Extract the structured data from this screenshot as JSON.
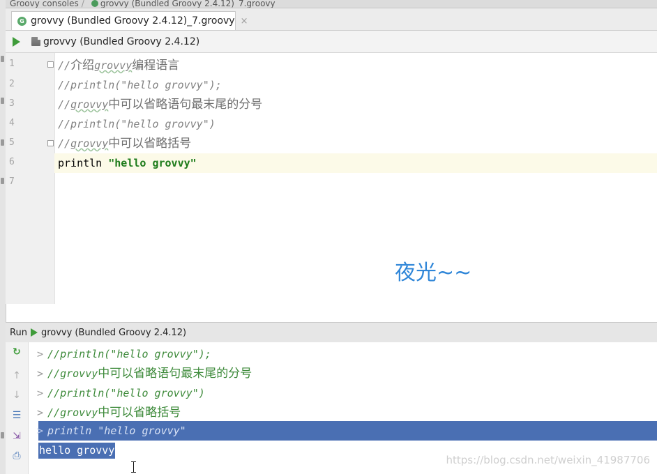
{
  "breadcrumb": {
    "root": "Groovy consoles",
    "file": "grovvy (Bundled Groovy 2.4.12)_7.groovy"
  },
  "tab": {
    "icon": "groovy-file-icon",
    "label": "grovvy (Bundled Groovy 2.4.12)_7.groovy",
    "close": "×"
  },
  "toolbar": {
    "run_config_label": "grovvy (Bundled Groovy 2.4.12)"
  },
  "editor": {
    "line_numbers": [
      "1",
      "2",
      "3",
      "4",
      "5",
      "6",
      "7"
    ],
    "lines": [
      {
        "prefix": "//",
        "cn1": "介绍",
        "mono": "grovvy",
        "cn2": "编程语言"
      },
      {
        "text": "//println(\"hello grovvy\");"
      },
      {
        "prefix": "//",
        "mono": "grovvy",
        "cn2": "中可以省略语句最末尾的分号"
      },
      {
        "text": "//println(\"hello grovvy\")"
      },
      {
        "prefix": "//",
        "mono": "grovvy",
        "cn2": "中可以省略括号"
      },
      {
        "keyword": "println ",
        "string": "\"hello grovvy\""
      }
    ],
    "overlay_text": "夜光~~"
  },
  "run_panel": {
    "run_label": "Run",
    "config_label": "grovvy (Bundled Groovy 2.4.12)",
    "prompt": ">",
    "output": [
      {
        "text": "//println(\"hello grovvy\");"
      },
      {
        "mono": "//grovvy",
        "cn": "中可以省略语句最末尾的分号"
      },
      {
        "text": "//println(\"hello grovvy\")"
      },
      {
        "mono": "//grovvy",
        "cn": "中可以省略括号"
      },
      {
        "text": "println \"hello grovvy\""
      }
    ],
    "result": "hello grovvy"
  },
  "watermark": "https://blog.csdn.net/weixin_41987706",
  "colors": {
    "accent_green": "#3f9c3a",
    "selection": "#4a6fb3",
    "string": "#1d7b1a",
    "overlay_blue": "#2f86d8"
  }
}
